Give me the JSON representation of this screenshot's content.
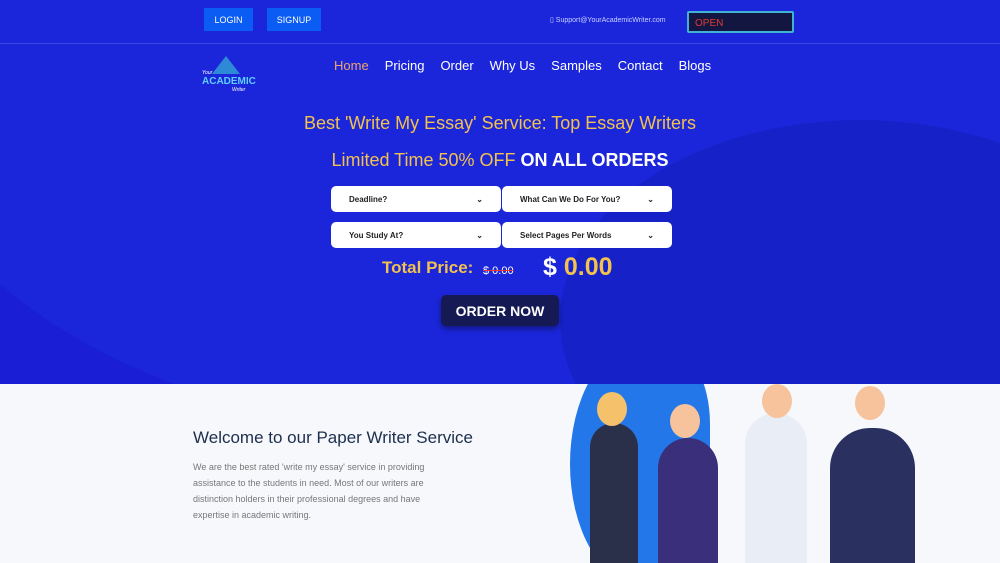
{
  "topbar": {
    "login": "LOGIN",
    "signup": "SIGNUP",
    "support_email": "Support@YourAcademicWriter.com",
    "status_sign": "OPEN"
  },
  "logo": {
    "small": "Your",
    "main": "ACADEMIC",
    "tail": "Writer"
  },
  "nav": {
    "items": [
      "Home",
      "Pricing",
      "Order",
      "Why Us",
      "Samples",
      "Contact",
      "Blogs"
    ],
    "active": "Home"
  },
  "hero": {
    "title": "Best 'Write My Essay' Service: Top Essay Writers",
    "offer": "Limited Time 50% OFF",
    "offer_bold": "ON ALL ORDERS"
  },
  "form": {
    "deadline": "Deadline?",
    "service": "What Can We Do For You?",
    "level": "You Study At?",
    "pages": "Select Pages Per Words"
  },
  "price": {
    "label": "Total Price:",
    "old": "$ 0.00",
    "currency": "$",
    "value": "0.00"
  },
  "order_button": "ORDER NOW",
  "welcome": {
    "title": "Welcome to our Paper Writer Service",
    "text": "We are the best rated 'write my essay' service in providing assistance to the students in need. Most of our writers are distinction holders in their professional degrees and have expertise in academic writing."
  },
  "colors": {
    "hero_bg": "#1a1fd6",
    "accent": "#f2c14e",
    "button": "#0a5cf5"
  }
}
